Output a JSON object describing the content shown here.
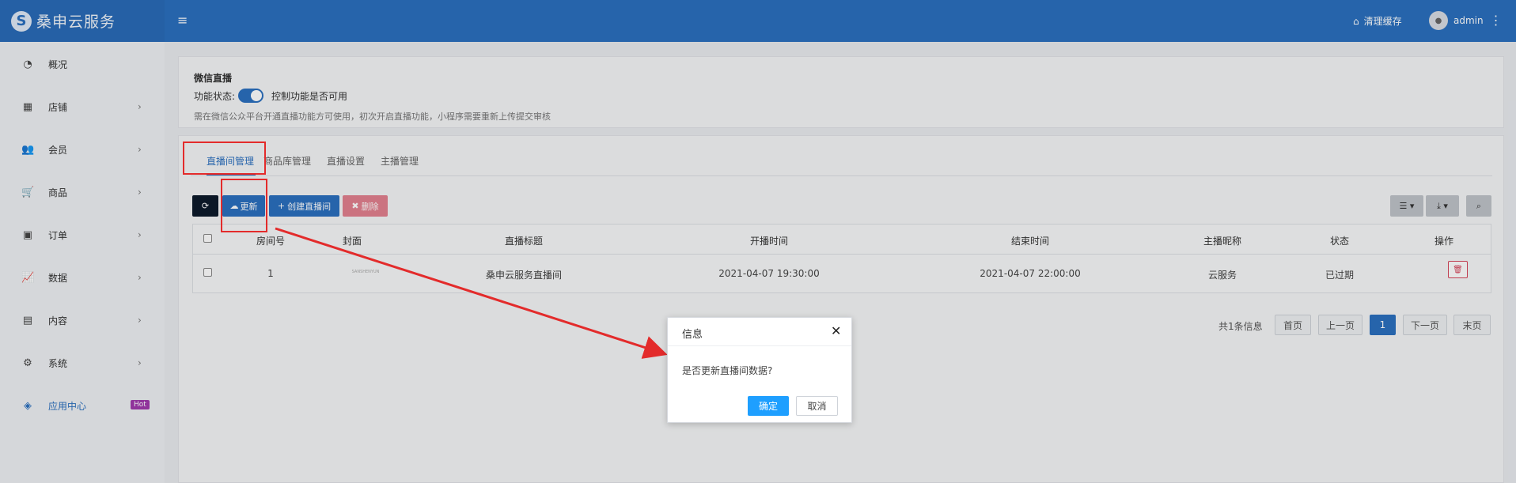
{
  "header": {
    "logo_mark": "S",
    "logo_text": "桑申云服务",
    "menu_icon": "hamburger-icon",
    "clear_cache_icon": "basket-icon",
    "clear_cache": "清理缓存",
    "user_avatar": "avatar-icon",
    "user_name": "admin",
    "more_icon": "vertical-dots-icon"
  },
  "sidebar": {
    "items": [
      {
        "label": "概况",
        "icon": "dashboard-icon",
        "glyph": "◔",
        "has_chevron": false
      },
      {
        "label": "店铺",
        "icon": "grid-icon",
        "glyph": "▦",
        "has_chevron": true
      },
      {
        "label": "会员",
        "icon": "users-icon",
        "glyph": "👥",
        "has_chevron": true
      },
      {
        "label": "商品",
        "icon": "cart-icon",
        "glyph": "🛒",
        "has_chevron": true
      },
      {
        "label": "订单",
        "icon": "money-icon",
        "glyph": "▣",
        "has_chevron": true
      },
      {
        "label": "数据",
        "icon": "line-chart-icon",
        "glyph": "📈",
        "has_chevron": true
      },
      {
        "label": "内容",
        "icon": "file-icon",
        "glyph": "▤",
        "has_chevron": true
      },
      {
        "label": "系统",
        "icon": "gear-icon",
        "glyph": "⚙",
        "has_chevron": true
      },
      {
        "label": "应用中心",
        "icon": "cube-icon",
        "glyph": "◈",
        "has_chevron": false,
        "badge": "Hot",
        "active": true
      }
    ],
    "chevron": "›"
  },
  "feature_panel": {
    "title": "微信直播",
    "status_label": "功能状态:",
    "toggle_on": true,
    "toggle_desc": "控制功能是否可用",
    "hint": "需在微信公众平台开通直播功能方可使用，初次开启直播功能，小程序需要重新上传提交审核"
  },
  "tabs": [
    {
      "label": "直播间管理",
      "active": true
    },
    {
      "label": "商品库管理",
      "active": false
    },
    {
      "label": "直播设置",
      "active": false
    },
    {
      "label": "主播管理",
      "active": false
    }
  ],
  "toolbar": {
    "refresh_icon": "refresh-icon",
    "update_icon": "cloud-download-icon",
    "update_label": "更新",
    "create_icon": "plus-icon",
    "create_label": "创建直播间",
    "delete_icon": "x-icon",
    "delete_label": "删除",
    "columns_icon": "list-icon",
    "export_icon": "download-icon",
    "search_icon": "search-icon"
  },
  "table": {
    "headers": [
      "房间号",
      "封面",
      "直播标题",
      "开播时间",
      "结束时间",
      "主播昵称",
      "状态",
      "操作"
    ],
    "rows": [
      {
        "room_id": "1",
        "cover": "SANSHENYUN",
        "title": "桑申云服务直播间",
        "start_time": "2021-04-07 19:30:00",
        "end_time": "2021-04-07 22:00:00",
        "anchor": "云服务",
        "status": "已过期",
        "action_icon": "trash-icon"
      }
    ]
  },
  "pagination": {
    "info": "共1条信息",
    "first": "首页",
    "prev": "上一页",
    "current": "1",
    "next": "下一页",
    "last": "末页"
  },
  "dialog": {
    "title": "信息",
    "close_icon": "close-icon",
    "message": "是否更新直播间数据?",
    "ok": "确定",
    "cancel": "取消"
  },
  "annotations": {
    "color": "#e32b2b"
  }
}
